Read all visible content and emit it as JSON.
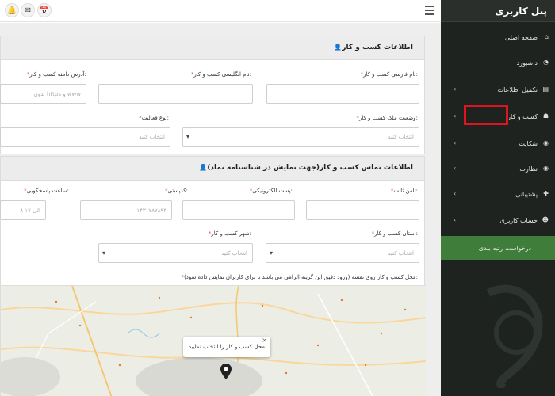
{
  "sidebar": {
    "brand": "پنل کاربری",
    "items": [
      {
        "label": "صفحه اصلی",
        "icon": "home-icon",
        "glyph": "⌂",
        "chevron": false
      },
      {
        "label": "داشبورد",
        "icon": "dashboard-icon",
        "glyph": "◔",
        "chevron": false
      },
      {
        "label": "تکمیل اطلاعات",
        "icon": "form-icon",
        "glyph": "▤",
        "chevron": true
      },
      {
        "label": "کسب و کار",
        "icon": "business-icon",
        "glyph": "☗",
        "chevron": true
      },
      {
        "label": "شکایت",
        "icon": "complaint-icon",
        "glyph": "◉",
        "chevron": true
      },
      {
        "label": "نظارت",
        "icon": "eye-icon",
        "glyph": "◉",
        "chevron": true
      },
      {
        "label": "پشتیبانی",
        "icon": "support-icon",
        "glyph": "✚",
        "chevron": true
      },
      {
        "label": "حساب کاربری",
        "icon": "user-icon",
        "glyph": "☻",
        "chevron": true
      },
      {
        "label": "درخواست رتبه بندی",
        "icon": "request-icon",
        "glyph": "",
        "chevron": false
      }
    ]
  },
  "business_info": {
    "title": "اطلاعات کسب و کار",
    "persian_name_label": "نام فارسی کسب و کار:",
    "english_name_label": "نام انگلیسی کسب و کار:",
    "domain_label": "آدرس دامنه کسب و کار:",
    "domain_placeholder": "بدون https و www",
    "ownership_label": "وضعیت ملک کسب و کار:",
    "ownership_placeholder": "انتخاب کنید",
    "activity_label": "نوع فعالیت:",
    "activity_placeholder": "انتخاب کنید"
  },
  "contact_info": {
    "title": "اطلاعات تماس کسب و کار(جهت نمایش در شناسنامه نماد)",
    "phone_label": "تلفن ثابت:",
    "email_label": "پست الکترونیکی:",
    "postal_label": "کدپستی:",
    "postal_placeholder": "۱۴۳۱۷۸۷۸۹۳",
    "hours_label": "ساعت پاسخگویی:",
    "hours_placeholder": "۸ الی ۱۷",
    "province_label": "استان کسب و کار:",
    "province_placeholder": "انتخاب کنید",
    "city_label": "شهر کسب و کار:",
    "city_placeholder": "انتخاب کنید",
    "map_label": "محل کسب و کار روی نقشه (ورود دقیق این گزینه الزامی می باشد تا برای کاربران نمایش داده شود):",
    "map_popup": "محل کسب و کار را انتخاب نمایید"
  },
  "colors": {
    "sidebar_bg": "#1f2320",
    "highlight": "#3e7d3a",
    "required_star": "#d9534f",
    "annotation": "#e0141e"
  }
}
